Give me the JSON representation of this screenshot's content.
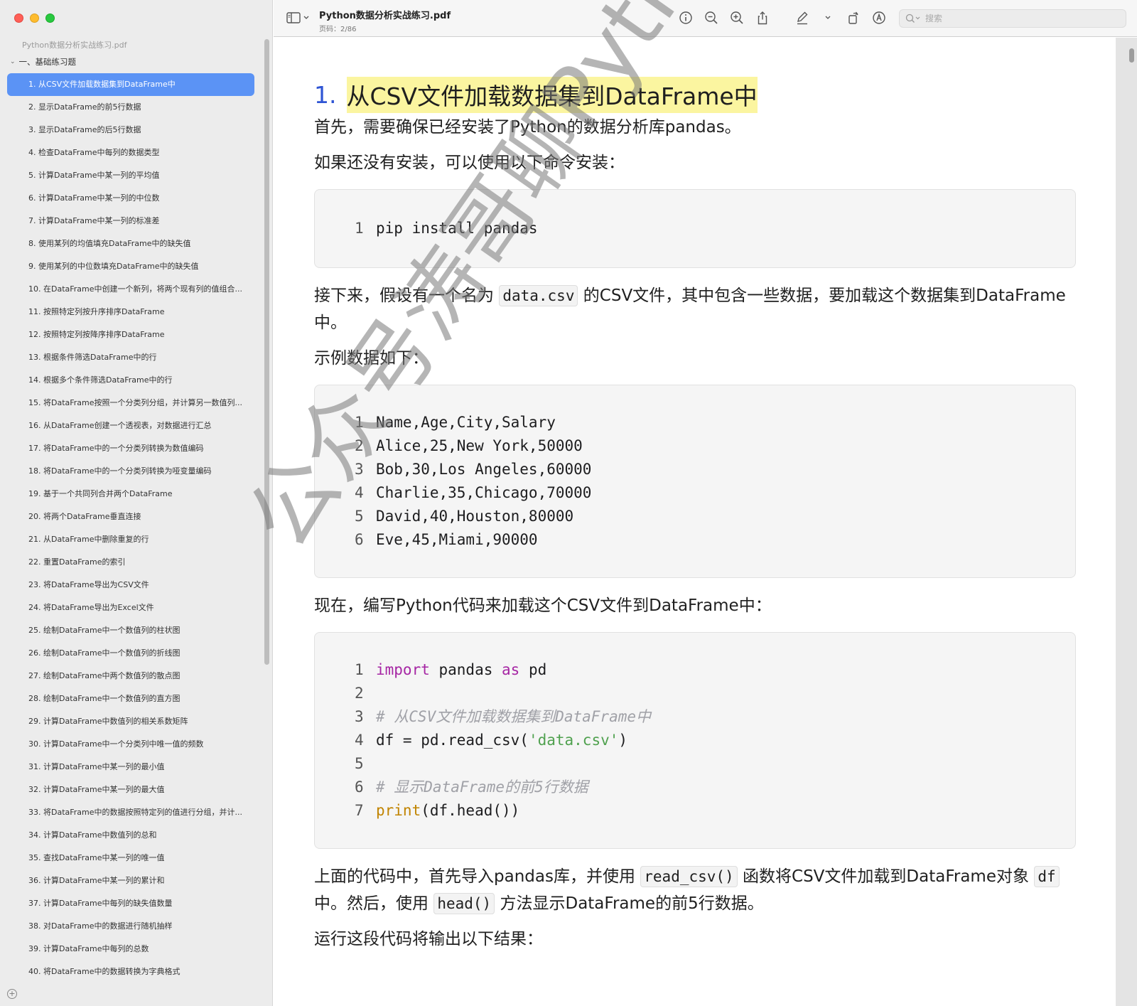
{
  "sidebar": {
    "file_name": "Python数据分析实战练习.pdf",
    "section": "一、基础练习题",
    "items": [
      "1. 从CSV文件加载数据集到DataFrame中",
      "2. 显示DataFrame的前5行数据",
      "3. 显示DataFrame的后5行数据",
      "4. 检查DataFrame中每列的数据类型",
      "5. 计算DataFrame中某一列的平均值",
      "6. 计算DataFrame中某一列的中位数",
      "7. 计算DataFrame中某一列的标准差",
      "8. 使用某列的均值填充DataFrame中的缺失值",
      "9. 使用某列的中位数填充DataFrame中的缺失值",
      "10. 在DataFrame中创建一个新列，将两个现有列的值组合...",
      "11. 按照特定列按升序排序DataFrame",
      "12. 按照特定列按降序排序DataFrame",
      "13. 根据条件筛选DataFrame中的行",
      "14. 根据多个条件筛选DataFrame中的行",
      "15. 将DataFrame按照一个分类列分组，并计算另一数值列...",
      "16. 从DataFrame创建一个透视表，对数据进行汇总",
      "17. 将DataFrame中的一个分类列转换为数值编码",
      "18. 将DataFrame中的一个分类列转换为哑变量编码",
      "19. 基于一个共同列合并两个DataFrame",
      "20. 将两个DataFrame垂直连接",
      "21. 从DataFrame中删除重复的行",
      "22. 重置DataFrame的索引",
      "23. 将DataFrame导出为CSV文件",
      "24. 将DataFrame导出为Excel文件",
      "25. 绘制DataFrame中一个数值列的柱状图",
      "26. 绘制DataFrame中一个数值列的折线图",
      "27. 绘制DataFrame中两个数值列的散点图",
      "28. 绘制DataFrame中一个数值列的直方图",
      "29. 计算DataFrame中数值列的相关系数矩阵",
      "30. 计算DataFrame中一个分类列中唯一值的频数",
      "31. 计算DataFrame中某一列的最小值",
      "32. 计算DataFrame中某一列的最大值",
      "33. 将DataFrame中的数据按照特定列的值进行分组，并计...",
      "34. 计算DataFrame中数值列的总和",
      "35. 查找DataFrame中某一列的唯一值",
      "36. 计算DataFrame中某一列的累计和",
      "37. 计算DataFrame中每列的缺失值数量",
      "38. 对DataFrame中的数据进行随机抽样",
      "39. 计算DataFrame中每列的总数",
      "40. 将DataFrame中的数据转换为字典格式"
    ]
  },
  "toolbar": {
    "title": "Python数据分析实战练习.pdf",
    "page": "页码：2/86",
    "search_placeholder": "搜索"
  },
  "doc": {
    "heading_num": "1.",
    "heading_text": "从CSV文件加载数据集到DataFrame中",
    "p1": "首先，需要确保已经安装了Python的数据分析库pandas。",
    "p2": "如果还没有安装，可以使用以下命令安装：",
    "code1": [
      {
        "n": "1",
        "text": "pip install pandas"
      }
    ],
    "p3_a": "接下来，假设有一个名为",
    "p3_code": "data.csv",
    "p3_b": "的CSV文件，其中包含一些数据，要加载这个数据集到DataFrame中。",
    "p4": "示例数据如下：",
    "code2": [
      {
        "n": "1",
        "text": "Name,Age,City,Salary"
      },
      {
        "n": "2",
        "text": "Alice,25,New York,50000"
      },
      {
        "n": "3",
        "text": "Bob,30,Los Angeles,60000"
      },
      {
        "n": "4",
        "text": "Charlie,35,Chicago,70000"
      },
      {
        "n": "5",
        "text": "David,40,Houston,80000"
      },
      {
        "n": "6",
        "text": "Eve,45,Miami,90000"
      }
    ],
    "p5": "现在，编写Python代码来加载这个CSV文件到DataFrame中：",
    "code3": {
      "l1_n": "1",
      "l1_kw1": "import",
      "l1_mid": " pandas ",
      "l1_kw2": "as",
      "l1_end": " pd",
      "l2_n": "2",
      "l3_n": "3",
      "l3_cm": "# 从CSV文件加载数据集到DataFrame中",
      "l4_n": "4",
      "l4_a": "df = pd.read_csv(",
      "l4_str": "'data.csv'",
      "l4_b": ")",
      "l5_n": "5",
      "l6_n": "6",
      "l6_cm": "# 显示DataFrame的前5行数据",
      "l7_n": "7",
      "l7_fn": "print",
      "l7_rest": "(df.head())"
    },
    "p6_a": "上面的代码中，首先导入pandas库，并使用",
    "p6_code1": "read_csv()",
    "p6_b": "函数将CSV文件加载到DataFrame对象",
    "p6_code2": "df",
    "p6_c": "中。然后，使用",
    "p6_code3": "head()",
    "p6_d": "方法显示DataFrame的前5行数据。",
    "p7": "运行这段代码将输出以下结果：",
    "watermark": "公众号涛哥聊Python"
  }
}
